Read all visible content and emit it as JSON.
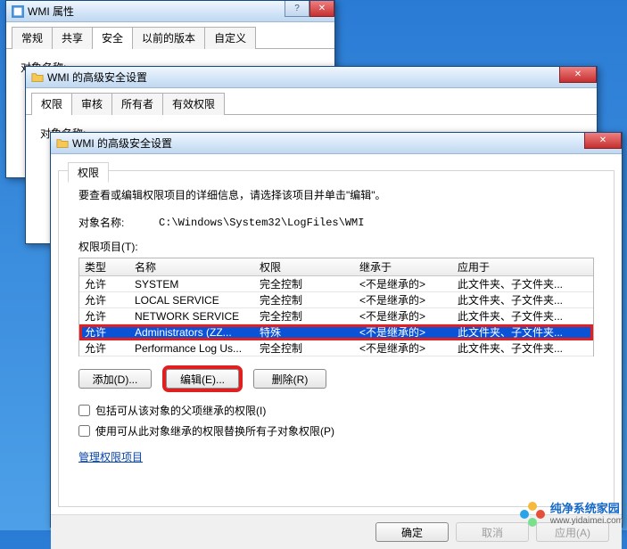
{
  "win1": {
    "title": "WMI 属性",
    "tabs": [
      "常规",
      "共享",
      "安全",
      "以前的版本",
      "自定义"
    ],
    "active_tab": 2,
    "label_objname": "对象名称:"
  },
  "win2": {
    "title": "WMI 的高级安全设置",
    "tabs": [
      "权限",
      "审核",
      "所有者",
      "有效权限"
    ],
    "active_tab": 0,
    "label_objname": "对象名称:"
  },
  "win3": {
    "title": "WMI 的高级安全设置",
    "inner_tab": "权限",
    "intro": "要查看或编辑权限项目的详细信息，请选择该项目并单击\"编辑\"。",
    "label_objname": "对象名称:",
    "objname_value": "C:\\Windows\\System32\\LogFiles\\WMI",
    "label_permitems": "权限项目(T):",
    "cols": [
      "类型",
      "名称",
      "权限",
      "继承于",
      "应用于"
    ],
    "rows": [
      {
        "c1": "允许",
        "c2": "SYSTEM",
        "c3": "完全控制",
        "c4": "<不是继承的>",
        "c5": "此文件夹、子文件夹..."
      },
      {
        "c1": "允许",
        "c2": "LOCAL SERVICE",
        "c3": "完全控制",
        "c4": "<不是继承的>",
        "c5": "此文件夹、子文件夹..."
      },
      {
        "c1": "允许",
        "c2": "NETWORK SERVICE",
        "c3": "完全控制",
        "c4": "<不是继承的>",
        "c5": "此文件夹、子文件夹..."
      },
      {
        "c1": "允许",
        "c2": "Administrators (ZZ...",
        "c3": "特殊",
        "c4": "<不是继承的>",
        "c5": "此文件夹、子文件夹..."
      },
      {
        "c1": "允许",
        "c2": "Performance Log Us...",
        "c3": "完全控制",
        "c4": "<不是继承的>",
        "c5": "此文件夹、子文件夹..."
      }
    ],
    "selected_row": 3,
    "btn_add": "添加(D)...",
    "btn_edit": "编辑(E)...",
    "btn_remove": "删除(R)",
    "chk1": "包括可从该对象的父项继承的权限(I)",
    "chk2": "使用可从此对象继承的权限替换所有子对象权限(P)",
    "link_manage": "管理权限项目",
    "btn_ok": "确定",
    "btn_cancel": "取消",
    "btn_apply": "应用(A)"
  },
  "watermark": {
    "url": "www.yidaimei.com",
    "brand": "纯净系统家园"
  }
}
